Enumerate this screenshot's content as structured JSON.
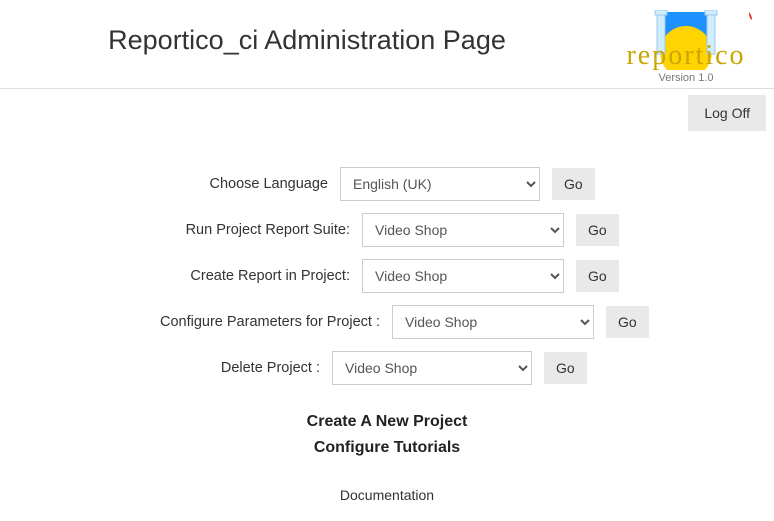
{
  "header": {
    "title": "Reportico_ci Administration Page",
    "version": "Version 1.0",
    "logo_text": "reportico"
  },
  "topbar": {
    "logoff": "Log Off"
  },
  "forms": {
    "language": {
      "label": "Choose Language",
      "value": "English (UK)",
      "go": "Go"
    },
    "run": {
      "label": "Run Project Report Suite:",
      "value": "Video Shop",
      "go": "Go"
    },
    "create": {
      "label": "Create Report in Project:",
      "value": "Video Shop",
      "go": "Go"
    },
    "configure": {
      "label": "Configure Parameters for Project :",
      "value": "Video Shop",
      "go": "Go"
    },
    "delete": {
      "label": "Delete Project :",
      "value": "Video Shop",
      "go": "Go"
    }
  },
  "links": {
    "new_project": "Create A New Project",
    "tutorials": "Configure Tutorials",
    "docs": "Documentation"
  }
}
